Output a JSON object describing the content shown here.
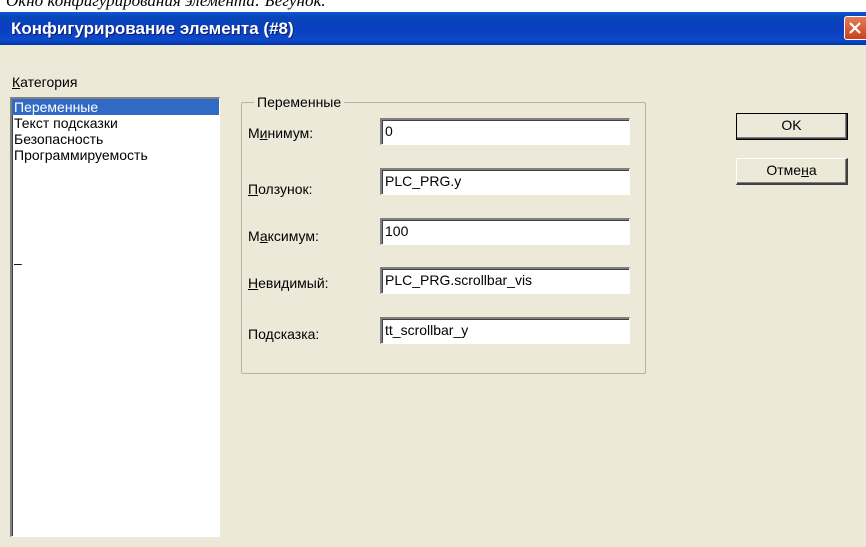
{
  "caption": "Окно конфигурирования элемента: Бегунок.",
  "window": {
    "title": "Конфигурирование элемента (#8)"
  },
  "category": {
    "label": "Категория",
    "items": [
      "Переменные",
      "Текст подсказки",
      "Безопасность",
      "Программируемость"
    ],
    "selected_index": 0,
    "extra_marker": "–"
  },
  "group": {
    "title": "Переменные",
    "fields": [
      {
        "label": "Минимум:",
        "value": "0"
      },
      {
        "label": "Ползунок:",
        "value": "PLC_PRG.y"
      },
      {
        "label": "Максимум:",
        "value": "100"
      },
      {
        "label": "Невидимый:",
        "value": "PLC_PRG.scrollbar_vis"
      },
      {
        "label": "Подсказка:",
        "value": "tt_scrollbar_y"
      }
    ]
  },
  "buttons": {
    "ok": "OK",
    "cancel": "Отмена"
  },
  "colors": {
    "titlebar": "#0a3ec0",
    "selection": "#316ac5",
    "dialog_bg": "#ece9d8",
    "close": "#c8421e"
  },
  "icons": {
    "close": "close-icon"
  }
}
